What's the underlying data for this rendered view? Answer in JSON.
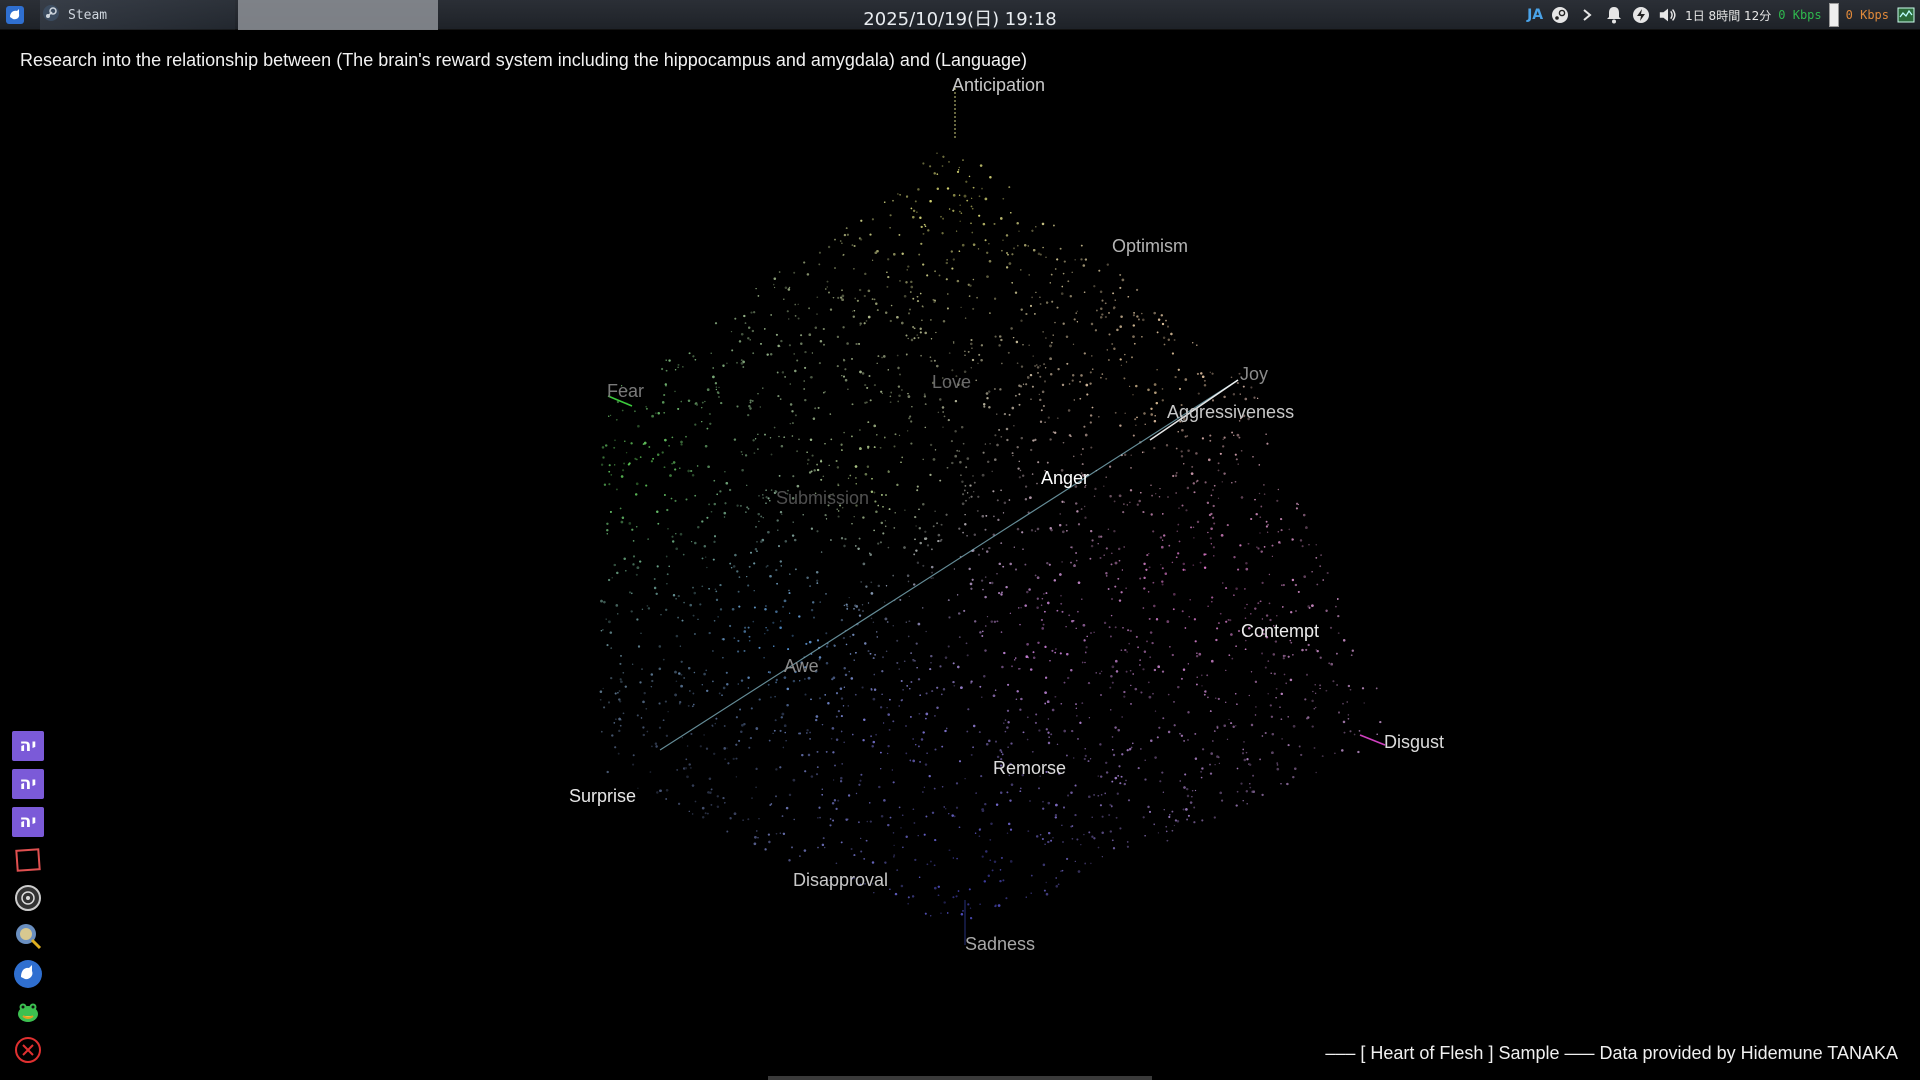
{
  "topbar": {
    "task_label": "Steam",
    "clock": "2025/10/19(日) 19:18",
    "ime": "JA",
    "uptime": "1日 8時間 12分",
    "net_down": "0 Kbps",
    "net_up": "0 Kbps"
  },
  "heading": "Research into the relationship between (The brain's reward system including the hippocampus and amygdala) and (Language)",
  "plot": {
    "labels": {
      "anticipation": "Anticipation",
      "optimism": "Optimism",
      "joy": "Joy",
      "aggressiveness": "Aggressiveness",
      "love": "Love",
      "fear": "Fear",
      "submission": "Submission",
      "anger": "Anger",
      "contempt": "Contempt",
      "awe": "Awe",
      "disgust": "Disgust",
      "remorse": "Remorse",
      "surprise": "Surprise",
      "disapproval": "Disapproval",
      "sadness": "Sadness"
    }
  },
  "dock": {
    "tile_glyph": "יה",
    "icons": [
      "hebrew-app-icon",
      "hebrew-app-icon",
      "hebrew-app-icon",
      "window-outline-icon",
      "disc-icon",
      "search-globe-icon",
      "launcher-hand-icon",
      "frog-icon",
      "close-circle-icon"
    ]
  },
  "footer": "––– [ Heart of Flesh ] Sample ––– Data provided by Hidemune TANAKA",
  "colors": {
    "clock_text": "#e8ecf0",
    "ime_blue": "#4aa3e8",
    "net_down_green": "#2fb84e",
    "net_up_orange": "#e0893a",
    "dock_purple": "#7b5ad8"
  }
}
